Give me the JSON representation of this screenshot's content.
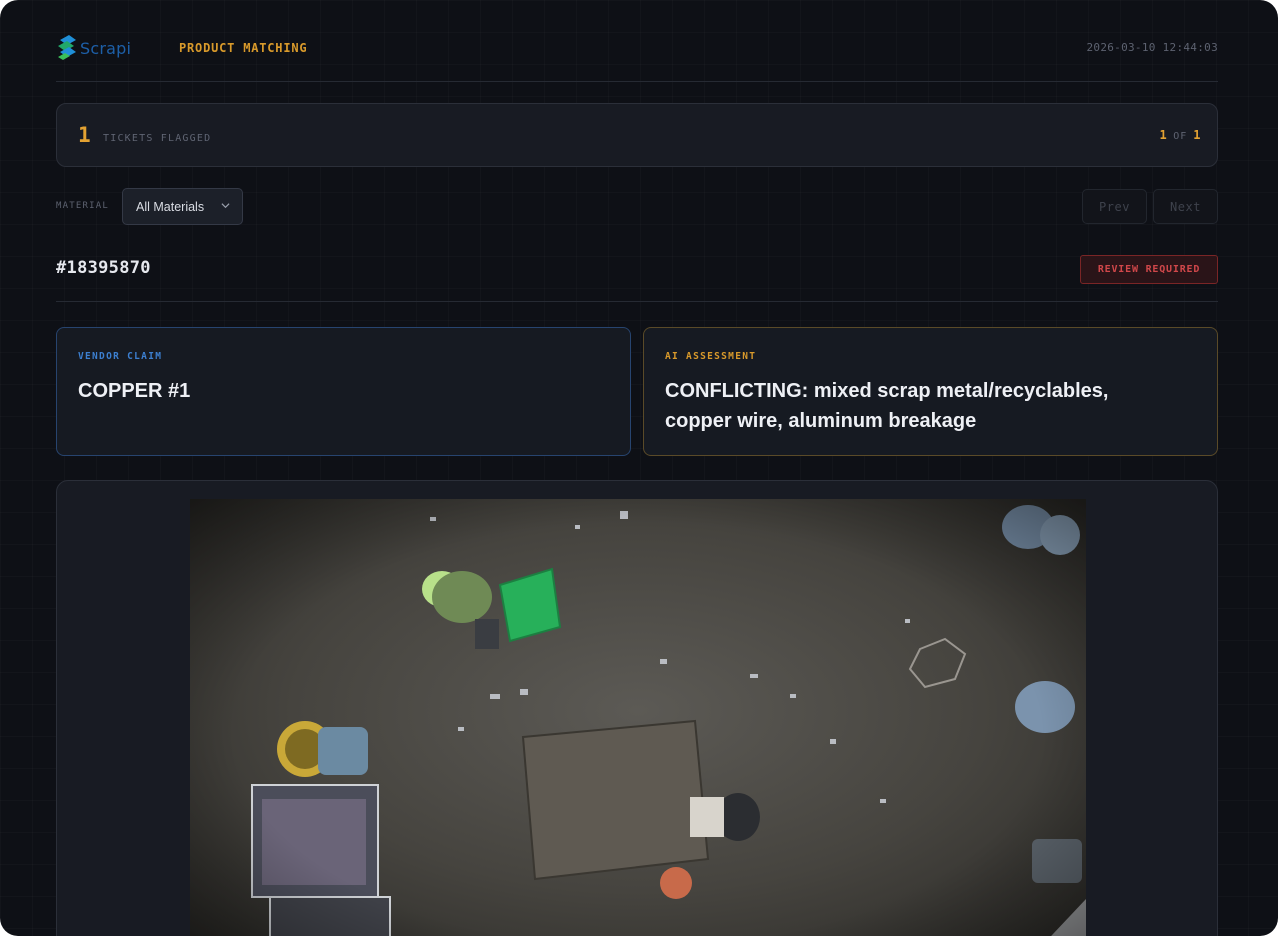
{
  "header": {
    "logo_text": "Scrapi",
    "page_title": "PRODUCT MATCHING",
    "timestamp": "2026-03-10 12:44:03"
  },
  "banner": {
    "count": "1",
    "label": "TICKETS FLAGGED",
    "current": "1",
    "of_label": "OF",
    "total": "1"
  },
  "filter": {
    "label": "MATERIAL",
    "selected": "All Materials"
  },
  "nav": {
    "prev": "Prev",
    "next": "Next"
  },
  "ticket": {
    "id": "#18395870",
    "status": "REVIEW REQUIRED"
  },
  "vendor_claim": {
    "label": "VENDOR CLAIM",
    "value": "COPPER #1"
  },
  "ai_assessment": {
    "label": "AI ASSESSMENT",
    "value": "CONFLICTING: mixed scrap metal/recyclables, copper wire, aluminum breakage"
  },
  "colors": {
    "accent": "#d99a2b",
    "vendor_blue": "#3c7fd0",
    "danger": "#d0474a",
    "background": "#0e1016"
  },
  "icons": {
    "logo": "scrapi-logo-icon",
    "dropdown": "chevron-down-icon"
  }
}
